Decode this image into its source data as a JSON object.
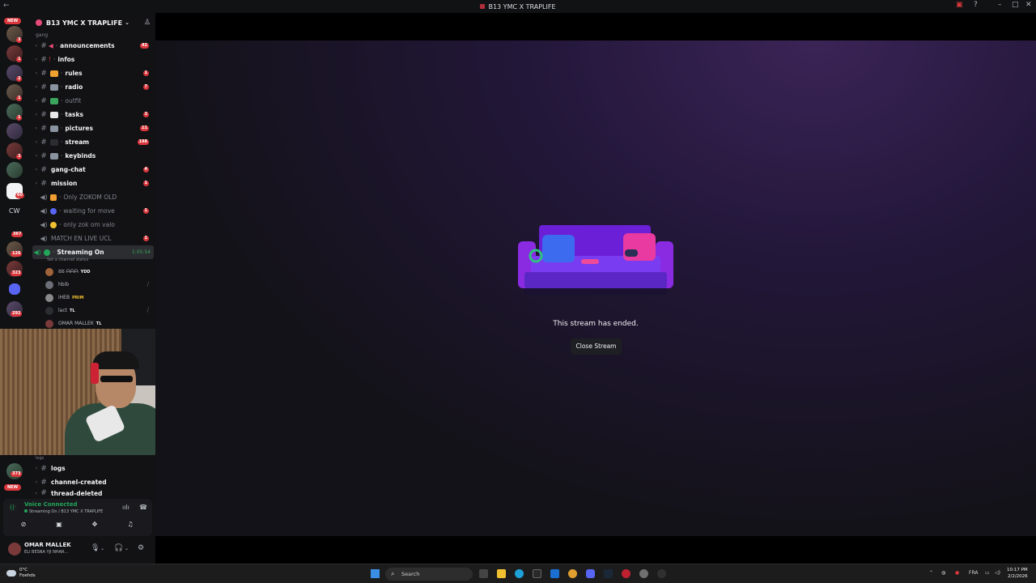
{
  "window": {
    "title": "B13 YMC X TRAPLIFE"
  },
  "rail": {
    "new_label": "NEW",
    "cw_label": "CW",
    "badges": [
      "3",
      "1",
      "2",
      "1",
      "1",
      "3",
      "60",
      "367",
      "126",
      "323",
      "292",
      "373"
    ]
  },
  "guild": {
    "name": "B13 YMC X TRAPLIFE",
    "category": "gang"
  },
  "channels": [
    {
      "label": "announcements",
      "count": "42"
    },
    {
      "label": "infos",
      "count": ""
    },
    {
      "label": "rules",
      "count": "1"
    },
    {
      "label": "radio",
      "count": "7"
    },
    {
      "label": "outfit",
      "count": ""
    },
    {
      "label": "tasks",
      "count": "3"
    },
    {
      "label": "pictures",
      "count": "11"
    },
    {
      "label": "stream",
      "count": "198"
    },
    {
      "label": "keybinds",
      "count": ""
    },
    {
      "label": "gang-chat",
      "count": "4"
    },
    {
      "label": "mission",
      "count": "1"
    }
  ],
  "voice_channels": [
    {
      "label": "Only ZOKOM OLD",
      "count": ""
    },
    {
      "label": "waiting for move",
      "count": "1"
    },
    {
      "label": "only zok om valo",
      "count": ""
    },
    {
      "label": "MATCH EN LIVE UCL",
      "count": "1"
    }
  ],
  "active_voice": {
    "label": "Streaming On",
    "timer": "1:05:54",
    "status_sub": "Set a channel status"
  },
  "voice_users": [
    {
      "name": "ᘜᘜ ᗩᗩᗩ",
      "tag": "YDD"
    },
    {
      "name": "hbib",
      "tag": ""
    },
    {
      "name": "iHEB",
      "tag": "PRIM"
    },
    {
      "name": "lact",
      "tag": "TL"
    },
    {
      "name": "OMAR MALLEK",
      "tag": "TL"
    }
  ],
  "lower": {
    "category": "logs",
    "channels": [
      {
        "label": "logs"
      },
      {
        "label": "channel-created"
      },
      {
        "label": "thread-deleted"
      }
    ]
  },
  "voice_panel": {
    "title": "Voice Connected",
    "subtitle": "Streaming On / B13 YMC X TRAPLIFE"
  },
  "user_panel": {
    "name": "OMAR MALLEK",
    "status": "ELI BESNA YJI NHAR..."
  },
  "stage": {
    "message": "This stream has ended.",
    "close_label": "Close Stream"
  },
  "taskbar": {
    "weather_temp": "0°C",
    "weather_desc": "Foehds",
    "search_label": "Search",
    "lang": "FRA",
    "time": "10:17 PM",
    "date": "2/2/2026"
  },
  "colors": {
    "accent": "#5865f2",
    "online": "#23a55a",
    "badge": "#da373c"
  }
}
